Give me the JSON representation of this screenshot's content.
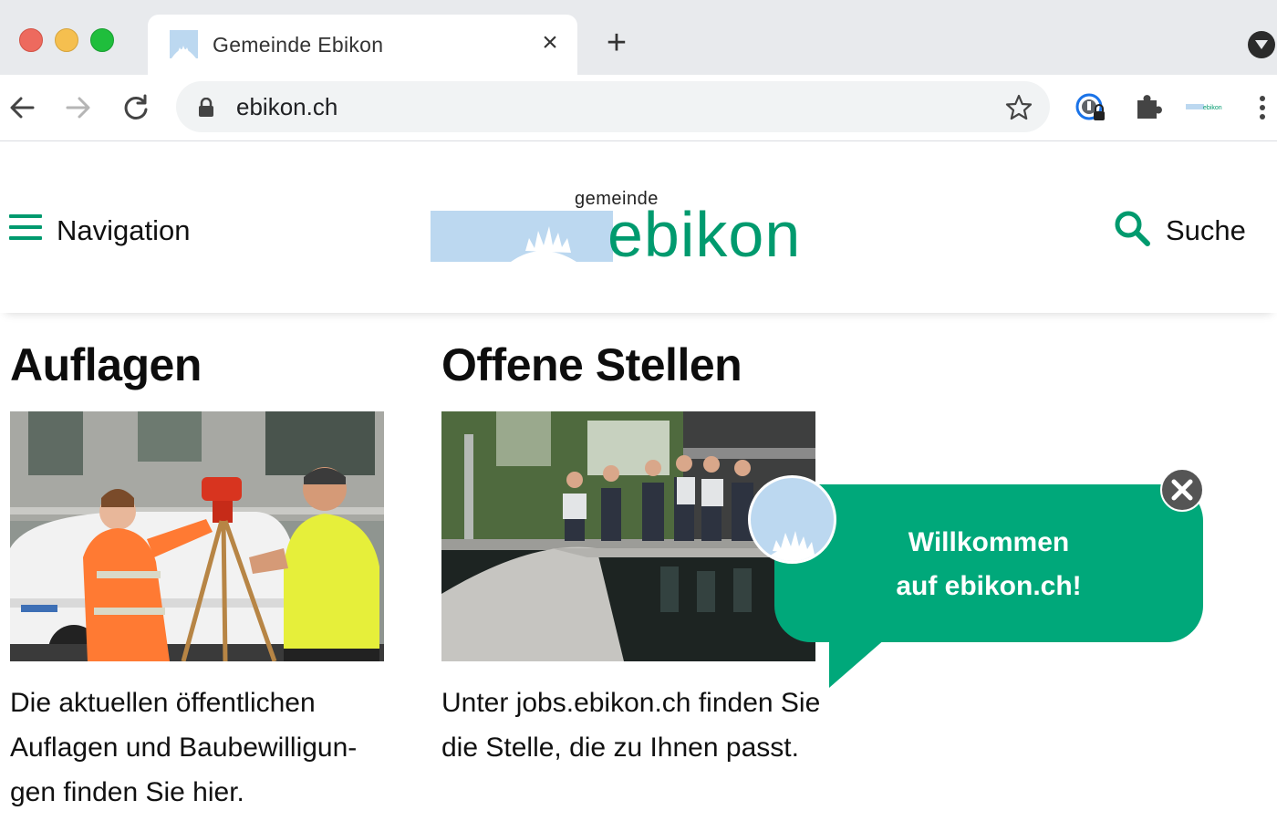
{
  "browser": {
    "tab_title": "Gemeinde Ebikon",
    "url": "ebikon.ch"
  },
  "header": {
    "nav_label": "Navigation",
    "logo_small": "gemeinde",
    "logo_big": "ebikon",
    "search_label": "Suche"
  },
  "sections": [
    {
      "title": "Auflagen",
      "text": "Die aktuellen öffentlichen Auflagen und Baubewilligun­gen finden Sie hier."
    },
    {
      "title": "Offene Stellen",
      "text": "Unter jobs.ebikon.ch finden Sie die Stelle, die zu Ihnen passt."
    }
  ],
  "welcome": {
    "line1": "Willkommen",
    "line2": "auf ebikon.ch!"
  },
  "colors": {
    "brand_green": "#009a6e",
    "bubble_green": "#00a87a",
    "sky_blue": "#bcd8f0"
  }
}
